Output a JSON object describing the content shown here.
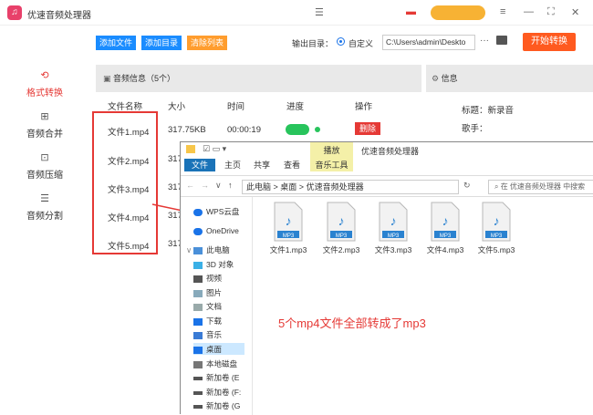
{
  "app": {
    "title": "优速音频处理器",
    "logo_glyph": "♫"
  },
  "colors": {
    "accent_blue": "#1a73e8",
    "add_btn_blue": "#1a8cff",
    "clear_btn_orange": "#ff9d2e",
    "start_orange": "#ff5a1f",
    "active_red": "#e53935",
    "toggle_green": "#28c45c",
    "user_pill": "#f7b234"
  },
  "window_controls": {
    "menu_icon": "menu-icon",
    "minimize_icon": "minimize-icon",
    "fullscreen_icon": "fullscreen-icon",
    "close_icon": "close-icon"
  },
  "sidebar": {
    "items": [
      {
        "label": "格式转换",
        "icon": "refresh-icon",
        "glyph": "⟲",
        "active": true
      },
      {
        "label": "音频合并",
        "icon": "merge-icon",
        "glyph": "⊞",
        "active": false
      },
      {
        "label": "音频压缩",
        "icon": "compress-icon",
        "glyph": "⊡",
        "active": false
      },
      {
        "label": "音频分割",
        "icon": "split-icon",
        "glyph": "☰",
        "active": false
      }
    ]
  },
  "toolbar": {
    "add_file": "添加文件",
    "add_folder": "添加目录",
    "clear_list": "清除列表",
    "output_label": "输出目录：",
    "custom_option": "自定义",
    "output_path": "C:\\Users\\admin\\Deskto",
    "more": "···",
    "start": "开始转换"
  },
  "audio_panel": {
    "title": "音频信息（5个）",
    "columns": [
      "文件名称",
      "大小",
      "时间",
      "进度",
      "操作"
    ],
    "rows": [
      {
        "name": "文件1.mp4",
        "size": "317.75KB",
        "time": "00:00:19",
        "action": "删除"
      },
      {
        "name": "文件2.mp4",
        "size": "317",
        "time": "",
        "action": ""
      },
      {
        "name": "文件3.mp4",
        "size": "317",
        "time": "",
        "action": ""
      },
      {
        "name": "文件4.mp4",
        "size": "317",
        "time": "",
        "action": ""
      },
      {
        "name": "文件5.mp4",
        "size": "317",
        "time": "",
        "action": ""
      }
    ]
  },
  "info_panel": {
    "title": "信息",
    "title_label": "标题：",
    "title_value": "新录音",
    "singer_label": "歌手："
  },
  "explorer": {
    "title": "优速音频处理器",
    "context_tab": "播放",
    "tabs": [
      "文件",
      "主页",
      "共享",
      "查看",
      "音乐工具"
    ],
    "breadcrumb": [
      "此电脑",
      "桌面",
      "优速音频处理器"
    ],
    "search_placeholder": "在 优速音频处理器 中搜索",
    "tree": [
      "WPS云盘",
      "OneDrive",
      "此电脑",
      "3D 对象",
      "视频",
      "图片",
      "文档",
      "下载",
      "音乐",
      "桌面",
      "本地磁盘",
      "新加卷 (E",
      "新加卷 (F:",
      "新加卷 (G"
    ],
    "files": [
      "文件1.mp3",
      "文件2.mp3",
      "文件3.mp3",
      "文件4.mp3",
      "文件5.mp3"
    ],
    "file_badge": "MP3"
  },
  "annotation": "5个mp4文件全部转成了mp3"
}
